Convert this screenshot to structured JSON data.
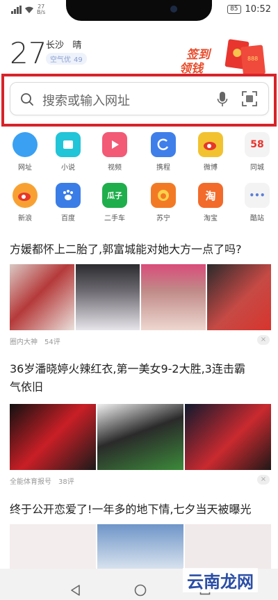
{
  "status_bar": {
    "speed": "27",
    "speed_unit": "B/s",
    "battery": "85",
    "time": "10:52"
  },
  "weather": {
    "temperature": "27",
    "city": "长沙",
    "condition": "晴",
    "air_label": "空气优",
    "aqi": "49"
  },
  "promo": {
    "line1": "签到",
    "line2": "领钱",
    "envelope_text": "888"
  },
  "search": {
    "placeholder": "搜索或输入网址",
    "mic_icon": "mic-icon",
    "scan_icon": "scan-icon",
    "highlight_color": "#d8232a"
  },
  "apps_row1": [
    {
      "label": "网址",
      "icon": "globe-icon",
      "color": "#3aa0f2"
    },
    {
      "label": "小说",
      "icon": "book-icon",
      "color": "#22c4d8"
    },
    {
      "label": "视频",
      "icon": "play-icon",
      "color": "#f25a76"
    },
    {
      "label": "携程",
      "icon": "ctrip-icon",
      "color": "#3f7fea"
    },
    {
      "label": "微博",
      "icon": "weibo-icon",
      "color": "#f2c230"
    },
    {
      "label": "同城",
      "icon": "58-icon",
      "color": "#f0f0f0",
      "glyph": "58"
    }
  ],
  "apps_row2": [
    {
      "label": "新浪",
      "icon": "sina-icon",
      "color": "#f8a132"
    },
    {
      "label": "百度",
      "icon": "baidu-icon",
      "color": "#3a7de6"
    },
    {
      "label": "二手车",
      "icon": "guazi-icon",
      "color": "#1fae4c",
      "glyph": "瓜子"
    },
    {
      "label": "苏宁",
      "icon": "suning-icon",
      "color": "#f37a25"
    },
    {
      "label": "淘宝",
      "icon": "taobao-icon",
      "color": "#f26b2a",
      "glyph": "淘"
    },
    {
      "label": "酷站",
      "icon": "more-icon",
      "color": "#f0f0f0",
      "glyph": "•••"
    }
  ],
  "news": [
    {
      "title": "方媛都怀上二胎了,郭富城能对她大方一点了吗?",
      "source": "圈内大神",
      "comments": "54评"
    },
    {
      "title_line1": "36岁潘晓婷火辣红衣,第一美女9-2大胜,3连击霸",
      "title_line2": "气依旧",
      "source": "全能体育报号",
      "comments": "38评"
    },
    {
      "title": "终于公开恋爱了!一年多的地下情,七夕当天被曝光"
    }
  ],
  "watermark": "云南龙网"
}
